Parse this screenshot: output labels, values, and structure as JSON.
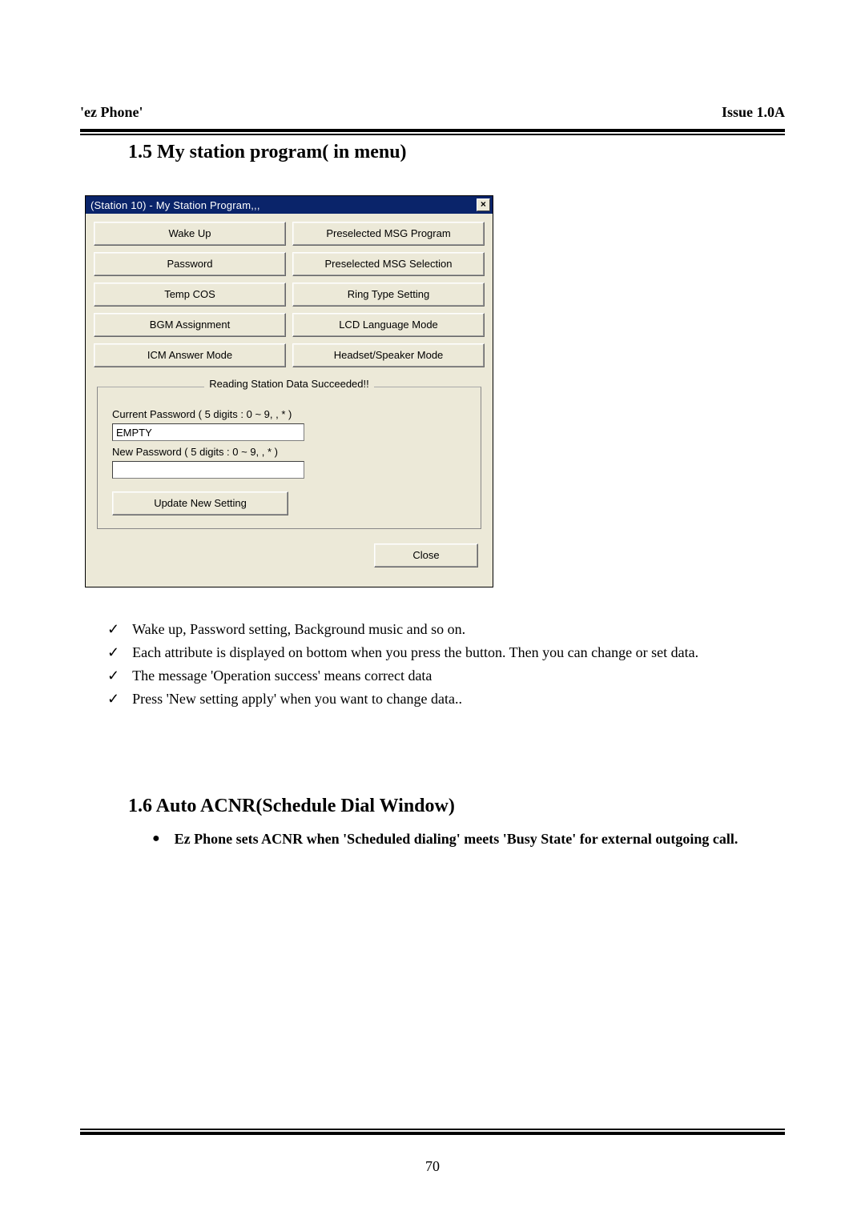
{
  "header": {
    "left": "'ez Phone'",
    "right": "Issue 1.0A"
  },
  "section15": {
    "title": "1.5 My station program( in menu)"
  },
  "dialog": {
    "title": "(Station 10) - My Station Program,,,",
    "close_x": "×",
    "buttons": {
      "wakeup": "Wake Up",
      "preselected_prog": "Preselected MSG Program",
      "password": "Password",
      "preselected_sel": "Preselected MSG Selection",
      "tempcos": "Temp COS",
      "ringtype": "Ring Type Setting",
      "bgm": "BGM Assignment",
      "lcdlang": "LCD Language Mode",
      "icm": "ICM Answer Mode",
      "headset": "Headset/Speaker Mode"
    },
    "group": {
      "legend": "Reading Station Data Succeeded!!",
      "current_pw_label": "Current Password ( 5 digits : 0 ~ 9, , * )",
      "current_pw_value": "EMPTY",
      "new_pw_label": "New Password ( 5 digits : 0 ~ 9, , * )",
      "new_pw_value": "",
      "update_btn": "Update New Setting"
    },
    "close_btn": "Close"
  },
  "checks": {
    "i0": "Wake up, Password setting, Background music and so on.",
    "i1": "Each attribute is displayed on bottom when you press the button. Then you can change or set data.",
    "i2": "The message 'Operation success' means correct data",
    "i3": "Press 'New setting apply' when you want to change data.."
  },
  "section16": {
    "title": "1.6 Auto ACNR(Schedule Dial Window)",
    "bullet0": "Ez Phone sets ACNR when 'Scheduled dialing' meets 'Busy State' for external outgoing call."
  },
  "page_num": "70"
}
